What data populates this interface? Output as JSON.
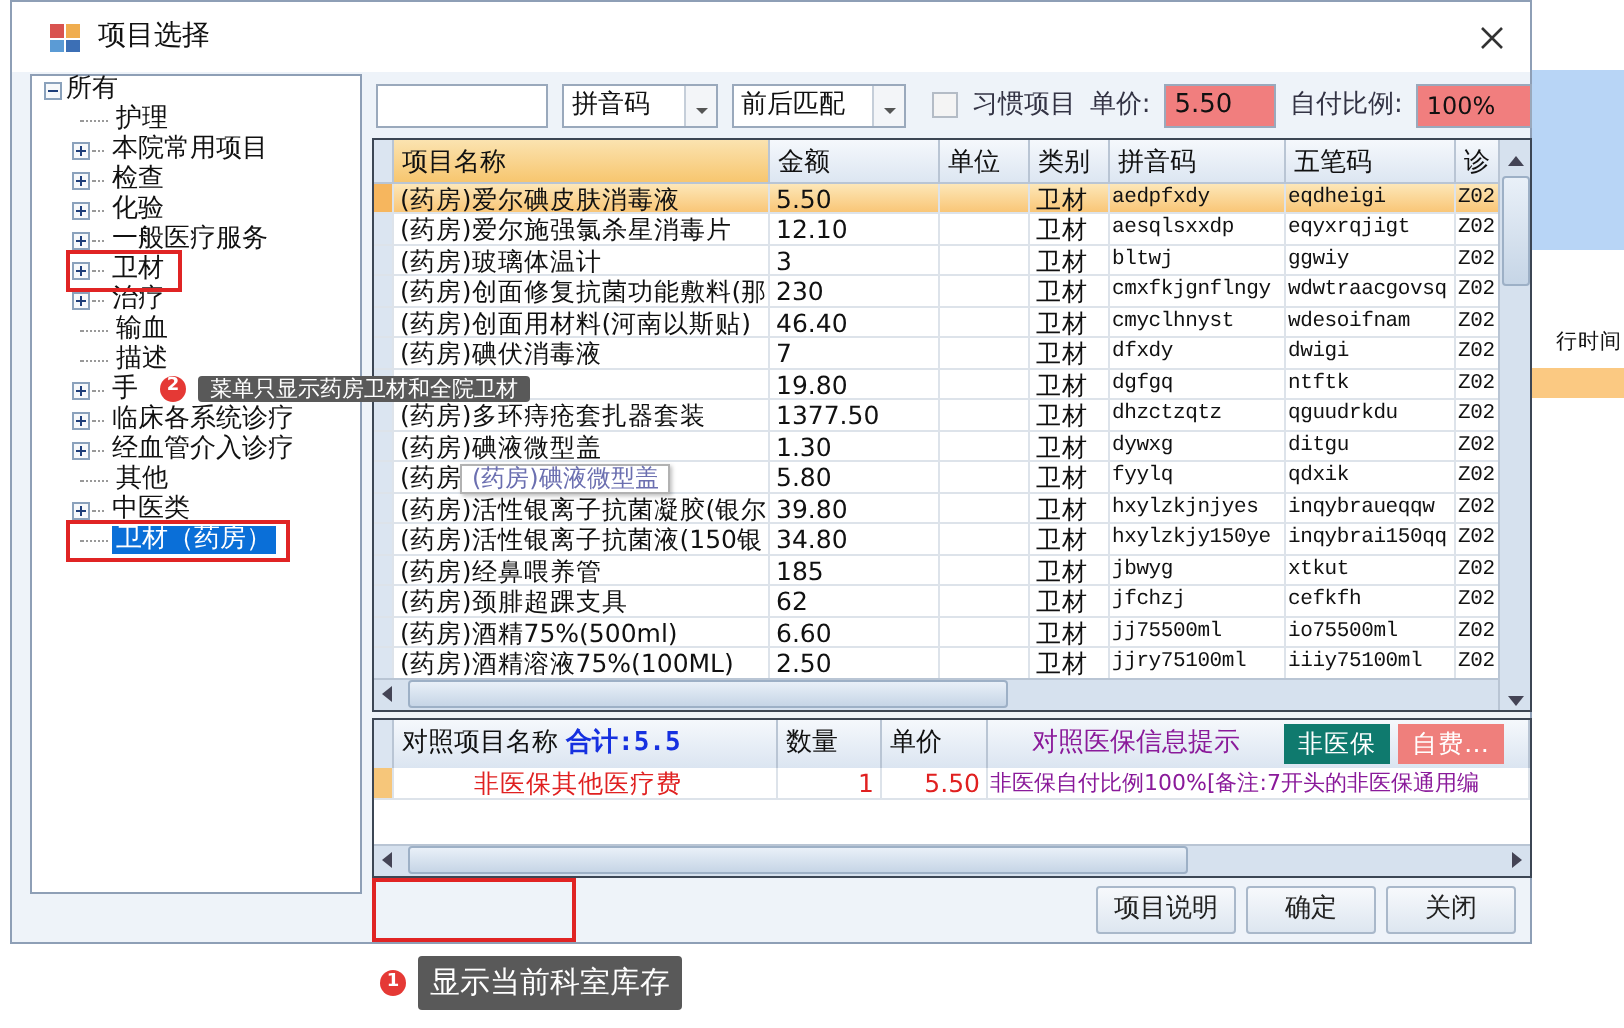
{
  "background_app": {
    "column_header": "行时间"
  },
  "window": {
    "title": "项目选择"
  },
  "tree": {
    "label": "所有",
    "expanded": true,
    "children": [
      {
        "label": "护理",
        "expandable": false,
        "selected": false,
        "highlighted": false
      },
      {
        "label": "本院常用项目",
        "expandable": true,
        "selected": false,
        "highlighted": false
      },
      {
        "label": "检查",
        "expandable": true,
        "selected": false,
        "highlighted": false
      },
      {
        "label": "化验",
        "expandable": true,
        "selected": false,
        "highlighted": false
      },
      {
        "label": "一般医疗服务",
        "expandable": true,
        "selected": false,
        "highlighted": false
      },
      {
        "label": "卫材",
        "expandable": true,
        "selected": false,
        "highlighted": true
      },
      {
        "label": "治疗",
        "expandable": true,
        "selected": false,
        "highlighted": false
      },
      {
        "label": "输血",
        "expandable": false,
        "selected": false,
        "highlighted": false
      },
      {
        "label": "描述",
        "expandable": false,
        "selected": false,
        "highlighted": false
      },
      {
        "label": "手",
        "expandable": true,
        "selected": false,
        "highlighted": false
      },
      {
        "label": "临床各系统诊疗",
        "expandable": true,
        "selected": false,
        "highlighted": false
      },
      {
        "label": "经血管介入诊疗",
        "expandable": true,
        "selected": false,
        "highlighted": false
      },
      {
        "label": "其他",
        "expandable": false,
        "selected": false,
        "highlighted": false
      },
      {
        "label": "中医类",
        "expandable": true,
        "selected": false,
        "highlighted": false
      },
      {
        "label": "卫材（药房）",
        "expandable": false,
        "selected": true,
        "highlighted": true
      }
    ]
  },
  "filters": {
    "mode": "拼音码",
    "match": "前后匹配",
    "habit_label": "习惯项目",
    "habit_checked": false,
    "price_label": "单价:",
    "price": "5.50",
    "ratio_label": "自付比例:",
    "ratio": "100%"
  },
  "grid": {
    "columns": [
      "项目名称",
      "金额",
      "单位",
      "类别",
      "拼音码",
      "五笔码",
      "诊"
    ],
    "rows": [
      {
        "name": "(药房)爱尔碘皮肤消毒液",
        "amount": "5.50",
        "category": "卫材",
        "pinyin": "aedpfxdy",
        "wubi": "eqdheigi",
        "code": "Z02",
        "selected": true
      },
      {
        "name": "(药房)爱尔施强氯杀星消毒片",
        "amount": "12.10",
        "category": "卫材",
        "pinyin": "aesqlsxxdp",
        "wubi": "eqyxrqjigt",
        "code": "Z02",
        "selected": false
      },
      {
        "name": "(药房)玻璃体温计",
        "amount": "3",
        "category": "卫材",
        "pinyin": "bltwj",
        "wubi": "ggwiy",
        "code": "Z02",
        "selected": false
      },
      {
        "name": "(药房)创面修复抗菌功能敷料(那",
        "amount": "230",
        "category": "卫材",
        "pinyin": "cmxfkjgnflngy",
        "wubi": "wdwtraacgovsq",
        "code": "Z02",
        "selected": false
      },
      {
        "name": "(药房)创面用材料(河南以斯贴)",
        "amount": "46.40",
        "category": "卫材",
        "pinyin": "cmyclhnyst",
        "wubi": "wdesoifnam",
        "code": "Z02",
        "selected": false
      },
      {
        "name": "(药房)碘伏消毒液",
        "amount": "7",
        "category": "卫材",
        "pinyin": "dfxdy",
        "wubi": "dwigi",
        "code": "Z02",
        "selected": false
      },
      {
        "amount": "19.80",
        "category": "卫材",
        "pinyin": "dgfgq",
        "wubi": "ntftk",
        "code": "Z02",
        "selected": false
      },
      {
        "name": "(药房)多环痔疮套扎器套装",
        "amount": "1377.50",
        "category": "卫材",
        "pinyin": "dhzctzqtz",
        "wubi": "qguudrkdu",
        "code": "Z02",
        "selected": false
      },
      {
        "name": "(药房)碘液微型盖",
        "amount": "1.30",
        "category": "卫材",
        "pinyin": "dywxg",
        "wubi": "ditgu",
        "code": "Z02",
        "selected": false
      },
      {
        "name": "(药房",
        "amount": "5.80",
        "category": "卫材",
        "pinyin": "fyylq",
        "wubi": "qdxik",
        "code": "Z02",
        "selected": false
      },
      {
        "name": "(药房)活性银离子抗菌凝胶(银尔",
        "amount": "39.80",
        "category": "卫材",
        "pinyin": "hxylzkjnjyes",
        "wubi": "inqybraueqqw",
        "code": "Z02",
        "selected": false
      },
      {
        "name": "(药房)活性银离子抗菌液(150银",
        "amount": "34.80",
        "category": "卫材",
        "pinyin": "hxylzkjy150ye",
        "wubi": "inqybrai150qq",
        "code": "Z02",
        "selected": false
      },
      {
        "name": "(药房)经鼻喂养管",
        "amount": "185",
        "category": "卫材",
        "pinyin": "jbwyg",
        "wubi": "xtkut",
        "code": "Z02",
        "selected": false
      },
      {
        "name": "(药房)颈腓超踝支具",
        "amount": "62",
        "category": "卫材",
        "pinyin": "jfchzj",
        "wubi": "cefkfh",
        "code": "Z02",
        "selected": false
      },
      {
        "name": "(药房)酒精75%(500ml)",
        "amount": "6.60",
        "category": "卫材",
        "pinyin": "jj75500ml",
        "wubi": "io75500ml",
        "code": "Z02",
        "selected": false
      },
      {
        "name": "(药房)酒精溶液75%(100ML)",
        "amount": "2.50",
        "category": "卫材",
        "pinyin": "jjry75100ml",
        "wubi": "iiiy75100ml",
        "code": "Z02",
        "selected": false
      }
    ]
  },
  "tooltip": "(药房)碘液微型盖",
  "detail": {
    "columns": [
      "对照项目名称",
      "数量",
      "单价"
    ],
    "total": "合计:5.5",
    "info_label": "对照医保信息提示",
    "tags": [
      {
        "text": "非医保",
        "color": "#0f7a6e"
      },
      {
        "text": "自费…",
        "color": "#ef7f7c"
      }
    ],
    "rows": [
      {
        "name": "非医保其他医疗费",
        "qty": "1",
        "price": "5.50",
        "info": "非医保自付比例100%[备注:7开头的非医保通用编"
      }
    ]
  },
  "footer": {
    "highlighted": true,
    "buttons": [
      "项目说明",
      "确定",
      "关闭"
    ]
  },
  "annotations": [
    {
      "number": "2",
      "text": "菜单只显示药房卫材和全院卫材"
    },
    {
      "number": "1",
      "text": "显示当前科室库存"
    }
  ]
}
